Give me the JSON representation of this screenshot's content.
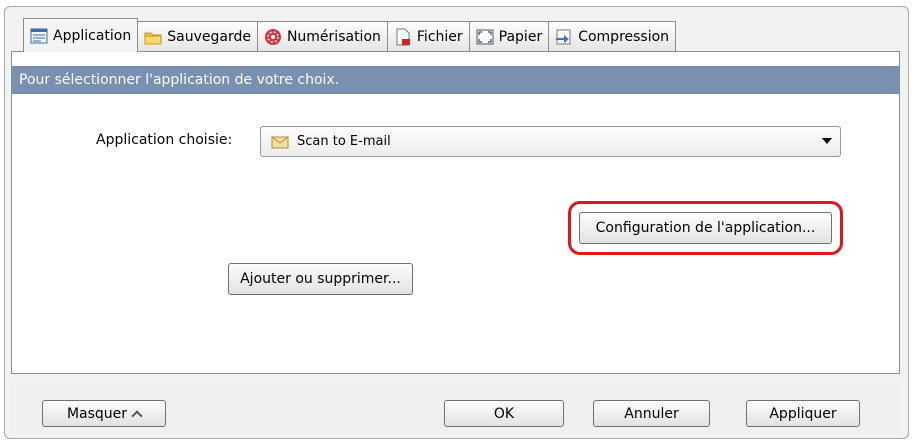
{
  "tabs": [
    {
      "label": "Application",
      "icon": "application-icon",
      "active": true
    },
    {
      "label": "Sauvegarde",
      "icon": "folder-icon",
      "active": false
    },
    {
      "label": "Numérisation",
      "icon": "scan-icon",
      "active": false
    },
    {
      "label": "Fichier",
      "icon": "file-icon",
      "active": false
    },
    {
      "label": "Papier",
      "icon": "paper-icon",
      "active": false
    },
    {
      "label": "Compression",
      "icon": "compression-icon",
      "active": false
    }
  ],
  "panel": {
    "banner": "Pour sélectionner l'application de votre choix.",
    "app_label": "Application choisie:",
    "app_selected": "Scan to E-mail",
    "config_button": "Configuration de l'application...",
    "add_remove_button": "Ajouter ou supprimer..."
  },
  "footer": {
    "hide_button": "Masquer",
    "ok_button": "OK",
    "cancel_button": "Annuler",
    "apply_button": "Appliquer"
  },
  "colors": {
    "banner": "#7990b1",
    "highlight": "#e4141b"
  }
}
